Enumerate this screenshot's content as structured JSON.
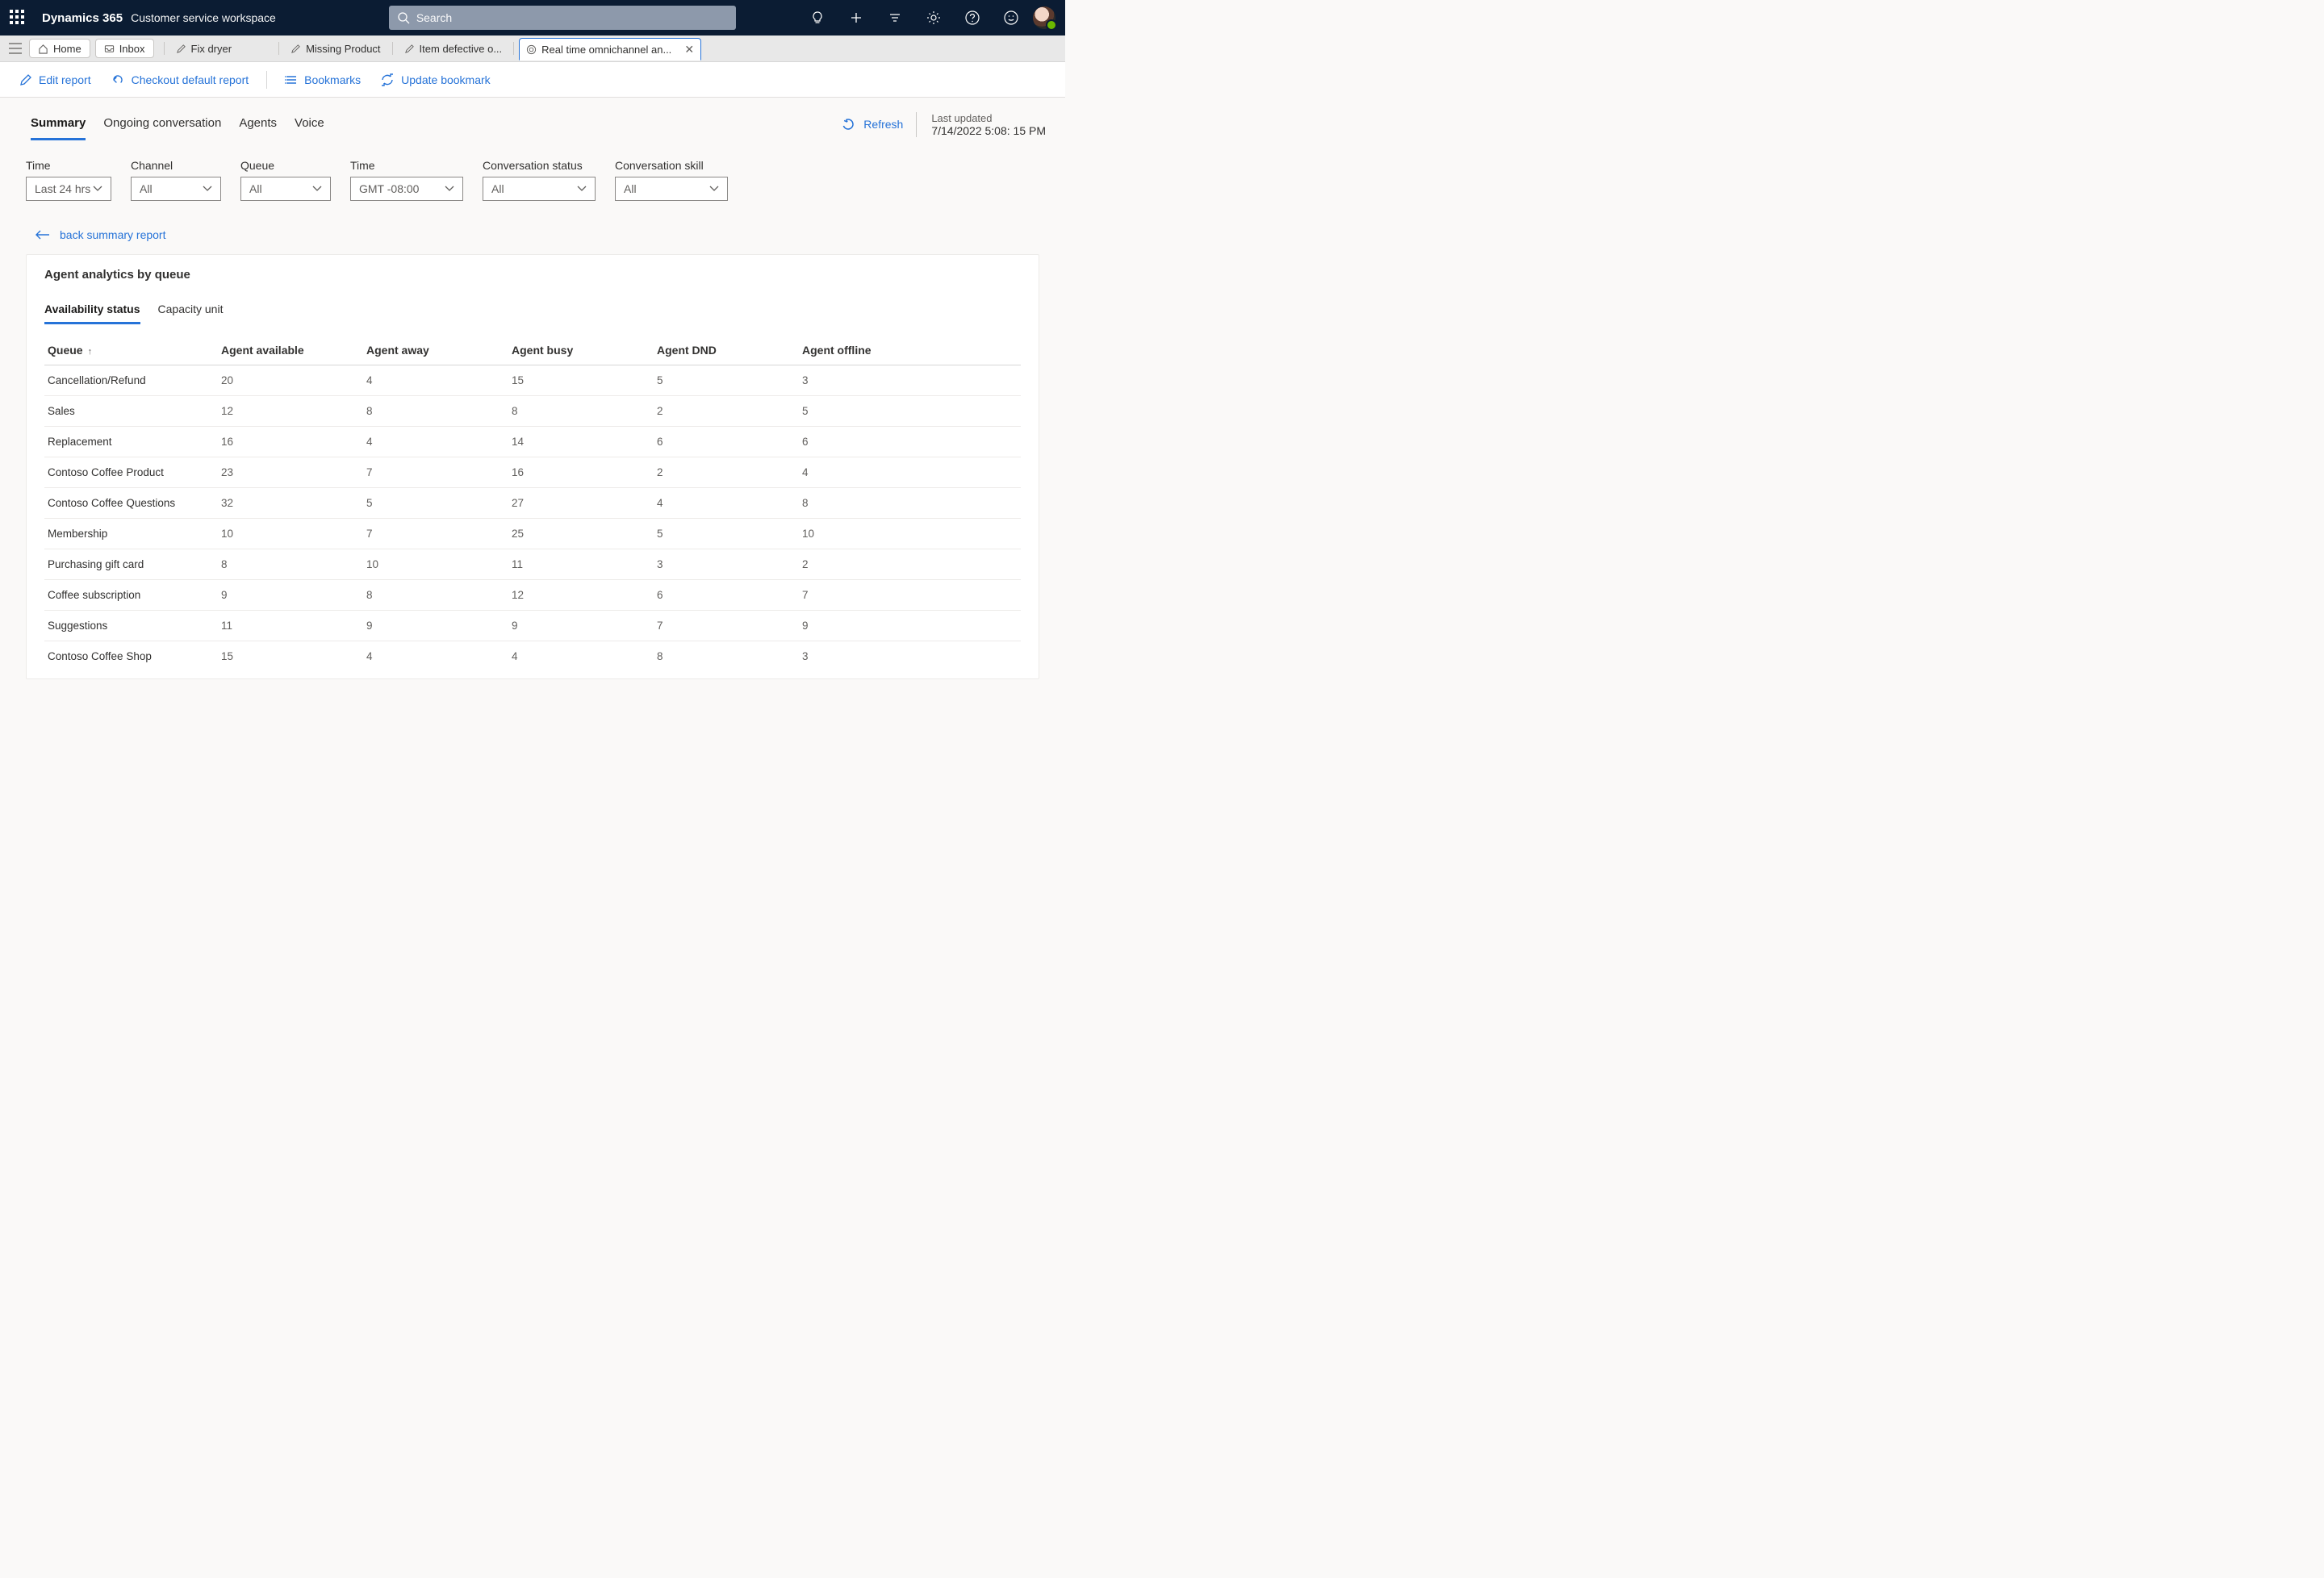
{
  "header": {
    "brand": "Dynamics 365",
    "app": "Customer service workspace",
    "search_placeholder": "Search"
  },
  "tabs": {
    "home": "Home",
    "inbox": "Inbox",
    "fix_dryer": "Fix dryer",
    "missing_product": "Missing Product",
    "item_defective": "Item defective o...",
    "realtime": "Real time omnichannel an..."
  },
  "commands": {
    "edit_report": "Edit report",
    "checkout_default": "Checkout default report",
    "bookmarks": "Bookmarks",
    "update_bookmark": "Update bookmark"
  },
  "mode_tabs": {
    "summary": "Summary",
    "ongoing": "Ongoing conversation",
    "agents": "Agents",
    "voice": "Voice"
  },
  "refresh_label": "Refresh",
  "last_updated": {
    "label": "Last updated",
    "value": "7/14/2022 5:08: 15 PM"
  },
  "filters": {
    "time": {
      "label": "Time",
      "value": "Last 24 hrs"
    },
    "channel": {
      "label": "Channel",
      "value": "All"
    },
    "queue": {
      "label": "Queue",
      "value": "All"
    },
    "tz": {
      "label": "Time",
      "value": "GMT -08:00"
    },
    "status": {
      "label": "Conversation status",
      "value": "All"
    },
    "skill": {
      "label": "Conversation skill",
      "value": "All"
    }
  },
  "back_link": "back summary report",
  "card": {
    "title": "Agent analytics by queue",
    "inner_tabs": {
      "availability": "Availability status",
      "capacity": "Capacity unit"
    }
  },
  "table": {
    "columns": [
      "Queue",
      "Agent available",
      "Agent away",
      "Agent busy",
      "Agent DND",
      "Agent offline"
    ],
    "rows": [
      [
        "Cancellation/Refund",
        "20",
        "4",
        "15",
        "5",
        "3"
      ],
      [
        "Sales",
        "12",
        "8",
        "8",
        "2",
        "5"
      ],
      [
        "Replacement",
        "16",
        "4",
        "14",
        "6",
        "6"
      ],
      [
        "Contoso Coffee Product",
        "23",
        "7",
        "16",
        "2",
        "4"
      ],
      [
        "Contoso Coffee Questions",
        "32",
        "5",
        "27",
        "4",
        "8"
      ],
      [
        "Membership",
        "10",
        "7",
        "25",
        "5",
        "10"
      ],
      [
        "Purchasing gift card",
        "8",
        "10",
        "11",
        "3",
        "2"
      ],
      [
        "Coffee subscription",
        "9",
        "8",
        "12",
        "6",
        "7"
      ],
      [
        "Suggestions",
        "11",
        "9",
        "9",
        "7",
        "9"
      ],
      [
        "Contoso Coffee Shop",
        "15",
        "4",
        "4",
        "8",
        "3"
      ]
    ]
  }
}
